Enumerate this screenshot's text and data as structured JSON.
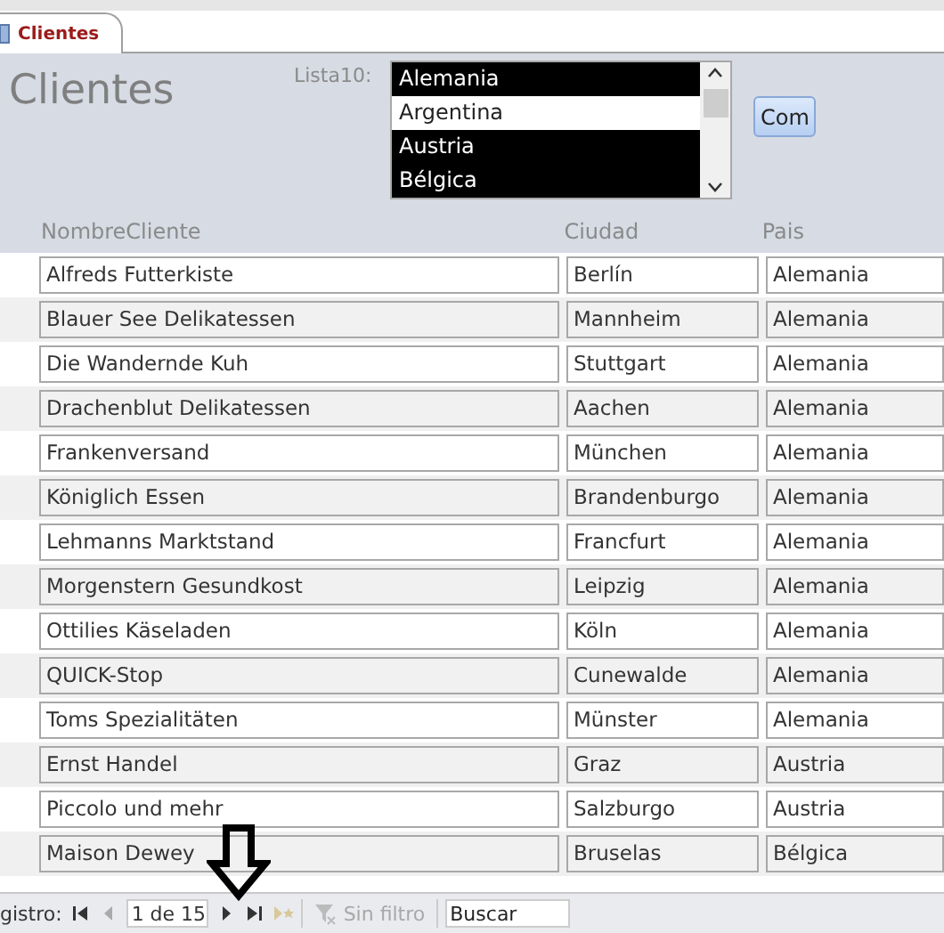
{
  "tab": {
    "label": "Clientes",
    "selected": true
  },
  "form_title": "Clientes",
  "listbox": {
    "label": "Lista10:",
    "items": [
      {
        "text": "Alemania",
        "selected": true
      },
      {
        "text": "Argentina",
        "selected": false
      },
      {
        "text": "Austria",
        "selected": true
      },
      {
        "text": "Bélgica",
        "selected": true
      }
    ]
  },
  "button": "Com",
  "table": {
    "columns": [
      "NombreCliente",
      "Ciudad",
      "Pais"
    ],
    "rows": [
      [
        "Alfreds Futterkiste",
        "Berlín",
        "Alemania"
      ],
      [
        "Blauer See Delikatessen",
        "Mannheim",
        "Alemania"
      ],
      [
        "Die Wandernde Kuh",
        "Stuttgart",
        "Alemania"
      ],
      [
        "Drachenblut Delikatessen",
        "Aachen",
        "Alemania"
      ],
      [
        "Frankenversand",
        "München",
        "Alemania"
      ],
      [
        "Königlich Essen",
        "Brandenburgo",
        "Alemania"
      ],
      [
        "Lehmanns Marktstand",
        "Francfurt",
        "Alemania"
      ],
      [
        "Morgenstern Gesundkost",
        "Leipzig",
        "Alemania"
      ],
      [
        "Ottilies Käseladen",
        "Köln",
        "Alemania"
      ],
      [
        "QUICK-Stop",
        "Cunewalde",
        "Alemania"
      ],
      [
        "Toms Spezialitäten",
        "Münster",
        "Alemania"
      ],
      [
        "Ernst Handel",
        "Graz",
        "Austria"
      ],
      [
        "Piccolo und mehr",
        "Salzburgo",
        "Austria"
      ],
      [
        "Maison Dewey",
        "Bruselas",
        "Bélgica"
      ]
    ]
  },
  "navigation": {
    "label": "gistro:",
    "record": "1 de 15",
    "filter": "Sin filtro",
    "filter_disabled": true,
    "search_placeholder": "Buscar"
  }
}
